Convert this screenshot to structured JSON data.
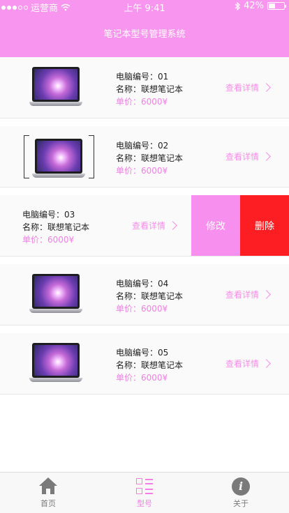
{
  "status_bar": {
    "carrier": "运营商",
    "time": "上午 9:41",
    "battery": "42%",
    "battery_level": 0.42
  },
  "header": {
    "title": "笔记本型号管理系统"
  },
  "items": [
    {
      "code": "电脑编号：01",
      "name": "名称：联想笔记本",
      "price": "单价：6000¥",
      "detail": "查看详情"
    },
    {
      "code": "电脑编号：02",
      "name": "名称：联想笔记本",
      "price": "单价：6000¥",
      "detail": "查看详情"
    },
    {
      "code": "电脑编号：03",
      "name": "名称：联想笔记本",
      "price": "单价：6000¥",
      "detail": "查看详情",
      "edit": "修改",
      "delete": "删除"
    },
    {
      "code": "电脑编号：04",
      "name": "名称：联想笔记本",
      "price": "单价：6000¥",
      "detail": "查看详情"
    },
    {
      "code": "电脑编号：05",
      "name": "名称：联想笔记本",
      "price": "单价：6000¥",
      "detail": "查看详情"
    }
  ],
  "tabbar": {
    "home": "首页",
    "model": "型号",
    "about": "关于",
    "active": "model"
  },
  "colors": {
    "accent": "#f895ef",
    "delete": "#fc1e22",
    "price": "#f17fe5"
  },
  "icons": [
    "signal-dots-icon",
    "wifi-icon",
    "bluetooth-icon",
    "battery-icon",
    "laptop-image",
    "chevron-right-icon",
    "home-icon",
    "grid-list-icon",
    "info-icon"
  ]
}
